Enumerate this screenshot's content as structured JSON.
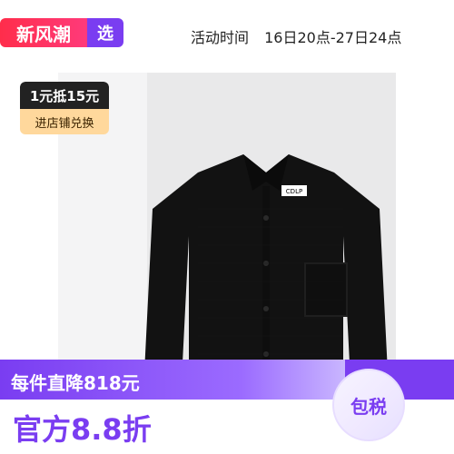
{
  "top_bar": {
    "brand_left": "新风潮",
    "brand_right": "选",
    "activity_label": "活动时间",
    "activity_range": "16日20点-27日24点"
  },
  "promo_sticker": {
    "headline": "1元抵15元",
    "action": "进店铺兑换"
  },
  "product": {
    "label_text": "CDLP"
  },
  "bottom_strip": {
    "discount_text": "每件直降818元",
    "official_discount": "官方8.8折",
    "tax_badge": "包税"
  },
  "colors": {
    "accent_purple": "#7a3df1",
    "brand_red": "#ff2d4b",
    "promo_dark": "#222222",
    "promo_gold": "#ffd89c"
  },
  "icons": {
    "product_image": "shirt-image",
    "tax_badge_icon": "circle-badge"
  }
}
